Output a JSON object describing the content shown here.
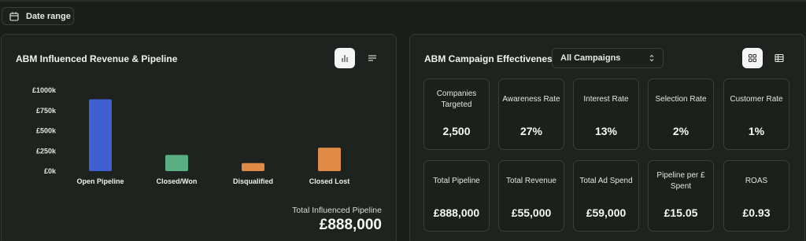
{
  "toolbar": {
    "date_range_label": "Date range"
  },
  "revenue_panel": {
    "title": "ABM Influenced Revenue & Pipeline",
    "total_label": "Total Influenced Pipeline",
    "total_value": "£888,000",
    "view_buttons": [
      {
        "icon": "bar-chart-icon",
        "active": true
      },
      {
        "icon": "list-icon",
        "active": false
      }
    ]
  },
  "chart_data": {
    "type": "bar",
    "categories": [
      "Open Pipeline",
      "Closed/Won",
      "Disqualified",
      "Closed Lost"
    ],
    "values": [
      888000,
      200000,
      100000,
      290000
    ],
    "colors": [
      "#3e60d2",
      "#5aaf82",
      "#e08a48",
      "#e08a48"
    ],
    "y_ticks": [
      "£0k",
      "£250k",
      "£500k",
      "£750k",
      "£1000k"
    ],
    "ylim": [
      0,
      1000000
    ],
    "grid": false
  },
  "campaign_panel": {
    "title": "ABM Campaign Effectiveness",
    "campaign_select": "All Campaigns",
    "view_buttons": [
      {
        "icon": "grid-icon",
        "active": true
      },
      {
        "icon": "table-icon",
        "active": false
      }
    ],
    "metrics_row1": [
      {
        "label": "Companies Targeted",
        "value": "2,500"
      },
      {
        "label": "Awareness Rate",
        "value": "27%"
      },
      {
        "label": "Interest Rate",
        "value": "13%"
      },
      {
        "label": "Selection Rate",
        "value": "2%"
      },
      {
        "label": "Customer Rate",
        "value": "1%"
      }
    ],
    "metrics_row2": [
      {
        "label": "Total Pipeline",
        "value": "£888,000"
      },
      {
        "label": "Total Revenue",
        "value": "£55,000"
      },
      {
        "label": "Total Ad Spend",
        "value": "£59,000"
      },
      {
        "label": "Pipeline per £ Spent",
        "value": "£15.05"
      },
      {
        "label": "ROAS",
        "value": "£0.93"
      }
    ]
  }
}
